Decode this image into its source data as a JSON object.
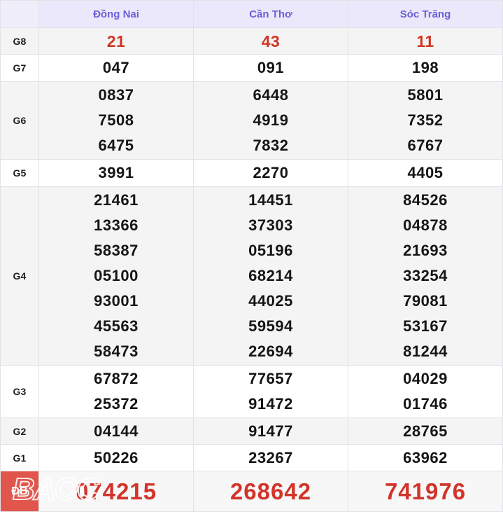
{
  "table": {
    "corner_label": "",
    "provinces": [
      "Đồng Nai",
      "Cần Thơ",
      "Sóc Trăng"
    ],
    "colors": {
      "header_bg": "#ebe8fb",
      "header_text": "#6a5fd8",
      "prize_red": "#cf3526",
      "special_red": "#d2342a",
      "special_label_bg": "#e0564c",
      "row_alt_bg": "#f4f4f4",
      "grid_line": "#e2e2e6"
    },
    "rows": [
      {
        "label": "G8",
        "cells": [
          [
            "21"
          ],
          [
            "43"
          ],
          [
            "11"
          ]
        ]
      },
      {
        "label": "G7",
        "cells": [
          [
            "047"
          ],
          [
            "091"
          ],
          [
            "198"
          ]
        ]
      },
      {
        "label": "G6",
        "cells": [
          [
            "0837",
            "7508",
            "6475"
          ],
          [
            "6448",
            "4919",
            "7832"
          ],
          [
            "5801",
            "7352",
            "6767"
          ]
        ]
      },
      {
        "label": "G5",
        "cells": [
          [
            "3991"
          ],
          [
            "2270"
          ],
          [
            "4405"
          ]
        ]
      },
      {
        "label": "G4",
        "cells": [
          [
            "21461",
            "13366",
            "58387",
            "05100",
            "93001",
            "45563",
            "58473"
          ],
          [
            "14451",
            "37303",
            "05196",
            "68214",
            "44025",
            "59594",
            "22694"
          ],
          [
            "84526",
            "04878",
            "21693",
            "33254",
            "79081",
            "53167",
            "81244"
          ]
        ]
      },
      {
        "label": "G3",
        "cells": [
          [
            "67872",
            "25372"
          ],
          [
            "77657",
            "91472"
          ],
          [
            "04029",
            "01746"
          ]
        ]
      },
      {
        "label": "G2",
        "cells": [
          [
            "04144"
          ],
          [
            "91477"
          ],
          [
            "28765"
          ]
        ]
      },
      {
        "label": "G1",
        "cells": [
          [
            "50226"
          ],
          [
            "23267"
          ],
          [
            "63962"
          ]
        ]
      },
      {
        "label": "ĐB",
        "cells": [
          [
            "074215"
          ],
          [
            "268642"
          ],
          [
            "741976"
          ]
        ]
      }
    ]
  },
  "watermark": {
    "text": "BAOC"
  }
}
